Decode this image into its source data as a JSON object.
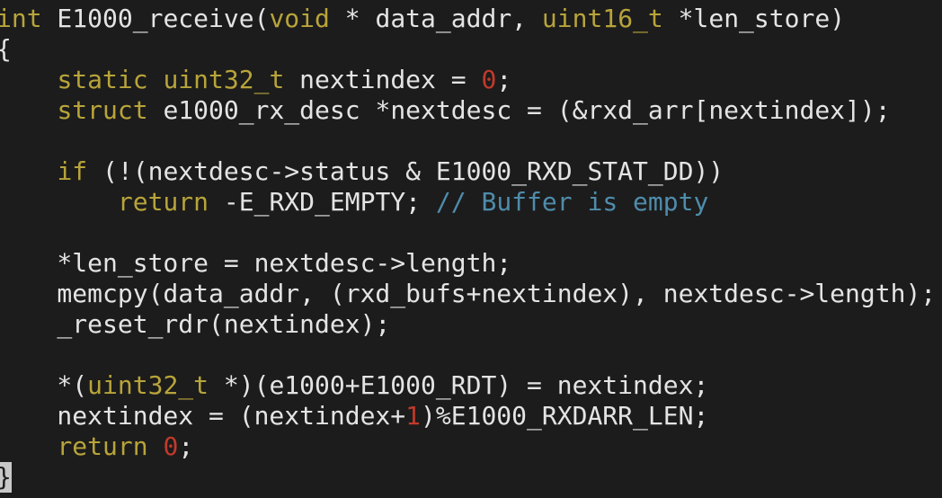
{
  "colors": {
    "background": "#1c1c1c",
    "default": "#e4e4e4",
    "keyword": "#b8a43a",
    "number": "#c13a2a",
    "comment": "#4f8cab",
    "cursor_bg": "#c8c8c8",
    "cursor_fg": "#1c1c1c"
  },
  "lines": [
    [
      {
        "t": "int",
        "k": "keyword"
      },
      {
        "t": " E1000_receive(",
        "k": "default"
      },
      {
        "t": "void",
        "k": "keyword"
      },
      {
        "t": " * data_addr, ",
        "k": "default"
      },
      {
        "t": "uint16_t",
        "k": "keyword"
      },
      {
        "t": " *len_store)",
        "k": "default"
      }
    ],
    [
      {
        "t": "{",
        "k": "default"
      }
    ],
    [
      {
        "t": "    ",
        "k": "default"
      },
      {
        "t": "static",
        "k": "keyword"
      },
      {
        "t": " ",
        "k": "default"
      },
      {
        "t": "uint32_t",
        "k": "keyword"
      },
      {
        "t": " nextindex = ",
        "k": "default"
      },
      {
        "t": "0",
        "k": "number"
      },
      {
        "t": ";",
        "k": "default"
      }
    ],
    [
      {
        "t": "    ",
        "k": "default"
      },
      {
        "t": "struct",
        "k": "keyword"
      },
      {
        "t": " e1000_rx_desc *nextdesc = (&rxd_arr[nextindex]);",
        "k": "default"
      }
    ],
    [],
    [
      {
        "t": "    ",
        "k": "default"
      },
      {
        "t": "if",
        "k": "keyword"
      },
      {
        "t": " (!(nextdesc->status & E1000_RXD_STAT_DD))",
        "k": "default"
      }
    ],
    [
      {
        "t": "        ",
        "k": "default"
      },
      {
        "t": "return",
        "k": "keyword"
      },
      {
        "t": " -E_RXD_EMPTY; ",
        "k": "default"
      },
      {
        "t": "// Buffer is empty",
        "k": "comment"
      }
    ],
    [],
    [
      {
        "t": "    *len_store = nextdesc->length;",
        "k": "default"
      }
    ],
    [
      {
        "t": "    memcpy(data_addr, (rxd_bufs+nextindex), nextdesc->length);",
        "k": "default"
      }
    ],
    [
      {
        "t": "    _reset_rdr(nextindex);",
        "k": "default"
      }
    ],
    [],
    [
      {
        "t": "    *(",
        "k": "default"
      },
      {
        "t": "uint32_t",
        "k": "keyword"
      },
      {
        "t": " *)(e1000+E1000_RDT) = nextindex;",
        "k": "default"
      }
    ],
    [
      {
        "t": "    nextindex = (nextindex+",
        "k": "default"
      },
      {
        "t": "1",
        "k": "number"
      },
      {
        "t": ")%E1000_RXDARR_LEN;",
        "k": "default"
      }
    ],
    [
      {
        "t": "    ",
        "k": "default"
      },
      {
        "t": "return",
        "k": "keyword"
      },
      {
        "t": " ",
        "k": "default"
      },
      {
        "t": "0",
        "k": "number"
      },
      {
        "t": ";",
        "k": "default"
      }
    ],
    [
      {
        "t": "}",
        "k": "cursor"
      }
    ]
  ]
}
